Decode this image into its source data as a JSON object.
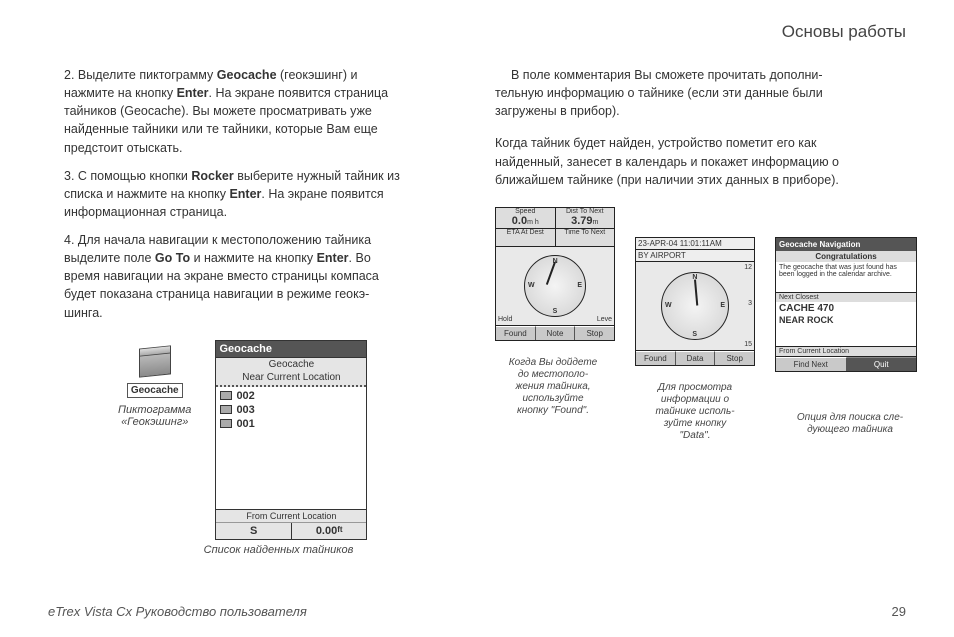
{
  "header": {
    "title": "Основы работы"
  },
  "leftCol": {
    "step2": {
      "num": "2. ",
      "l1a": "Выделите пиктограмму ",
      "l1b": "Geocache",
      "l1c": " (геокэшинг) и",
      "l2a": "нажмите на кнопку ",
      "l2b": "Enter",
      "l2c": ". На экране появится страница",
      "l3": "тайников (Geocache). Вы можете просматривать уже",
      "l4": "найденные тайники или те тайники, которые Вам еще",
      "l5": "предстоит отыскать."
    },
    "step3": {
      "num": "3. ",
      "l1a": "С помощью кнопки ",
      "l1b": "Rocker",
      "l1c": " выберите нужный тайник из",
      "l2a": "списка и нажмите на кнопку ",
      "l2b": "Enter",
      "l2c": ". На экране появится",
      "l3": "информационная страница."
    },
    "step4": {
      "num": "4. ",
      "l1": "Для начала навигации к местоположению тайника",
      "l2a": "выделите поле ",
      "l2b": "Go To",
      "l2c": " и нажмите на кнопку ",
      "l2d": "Enter",
      "l2e": ". Во",
      "l3": "время навигации на экране вместо страницы компаса",
      "l4": "будет показана страница навигации в режиме геокэ-",
      "l5": "шинга."
    },
    "fig1": {
      "iconLabel": "Geocache",
      "piktoLine1": "Пиктограмма",
      "piktoLine2": "«Геокэшинг»",
      "screenTitle": "Geocache",
      "screenSub1": "Geocache",
      "screenSub2": "Near Current Location",
      "items": [
        "002",
        "003",
        "001"
      ],
      "footLabel": "From Current Location",
      "footDir": "S",
      "footDist": "0.00",
      "footUnit": "ft",
      "caption": "Список найденных тайников"
    }
  },
  "rightCol": {
    "paraA": {
      "indent": "В поле комментария Вы сможете прочитать дополни-",
      "l2": "тельную информацию о тайнике (если эти данные были",
      "l3": "загружены в прибор)."
    },
    "paraB": {
      "l1": "Когда тайник будет найден, устройство пометит его как",
      "l2": "найденный, занесет в календарь и покажет информацию о",
      "l3": "ближайшем тайнике (при наличии этих данных в приборе)."
    },
    "mini1": {
      "speedLab": "Speed",
      "speedVal": "0.0",
      "speedUnit": "m h",
      "distLab": "Dist To Next",
      "distVal": "3.79",
      "distUnit": "m",
      "etaLab": "ETA At Dest",
      "ttnLab": "Time To Next",
      "leftSide": "Hold",
      "rightSide": "Leve",
      "N": "N",
      "E": "E",
      "S": "S",
      "W": "W",
      "btn1": "Found",
      "btn2": "Note",
      "btn3": "Stop"
    },
    "mini2": {
      "topline": "23-APR-04 11:01:11AM",
      "topline2": "BY AIRPORT",
      "N": "N",
      "E": "E",
      "S": "S",
      "W": "W",
      "d12": "12",
      "d3": "3",
      "d15": "15",
      "btn1": "Found",
      "btn2": "Data",
      "btn3": "Stop"
    },
    "mini3": {
      "title": "Geocache Navigation",
      "congrats": "Congratulations",
      "msg": "The geocache that was just found has been logged in the calendar archive.",
      "nextClosest": "Next Closest",
      "cache": "CACHE 470",
      "near": "NEAR ROCK",
      "fcl": "From Current Location",
      "btnFind": "Find Next",
      "btnQuit": "Quit"
    },
    "cap1": {
      "l1": "Когда Вы дойдете",
      "l2": "до местополо-",
      "l3": "жения тайника,",
      "l4": "используйте",
      "l5": "кнопку \"Found\"."
    },
    "cap2": {
      "l1": "Для просмотра",
      "l2": "информации о",
      "l3": "тайнике исполь-",
      "l4": "зуйте кнопку",
      "l5": "\"Data\"."
    },
    "cap3": {
      "l1": "Опция для поиска сле-",
      "l2": "дующего тайника"
    }
  },
  "footer": {
    "book": "eTrex Vista Cx Руководство пользователя",
    "page": "29"
  }
}
